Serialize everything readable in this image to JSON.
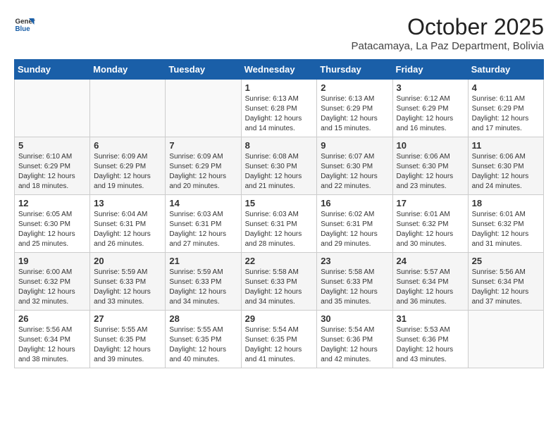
{
  "header": {
    "logo_line1": "General",
    "logo_line2": "Blue",
    "month": "October 2025",
    "location": "Patacamaya, La Paz Department, Bolivia"
  },
  "weekdays": [
    "Sunday",
    "Monday",
    "Tuesday",
    "Wednesday",
    "Thursday",
    "Friday",
    "Saturday"
  ],
  "weeks": [
    [
      {
        "day": "",
        "info": ""
      },
      {
        "day": "",
        "info": ""
      },
      {
        "day": "",
        "info": ""
      },
      {
        "day": "1",
        "info": "Sunrise: 6:13 AM\nSunset: 6:28 PM\nDaylight: 12 hours\nand 14 minutes."
      },
      {
        "day": "2",
        "info": "Sunrise: 6:13 AM\nSunset: 6:29 PM\nDaylight: 12 hours\nand 15 minutes."
      },
      {
        "day": "3",
        "info": "Sunrise: 6:12 AM\nSunset: 6:29 PM\nDaylight: 12 hours\nand 16 minutes."
      },
      {
        "day": "4",
        "info": "Sunrise: 6:11 AM\nSunset: 6:29 PM\nDaylight: 12 hours\nand 17 minutes."
      }
    ],
    [
      {
        "day": "5",
        "info": "Sunrise: 6:10 AM\nSunset: 6:29 PM\nDaylight: 12 hours\nand 18 minutes."
      },
      {
        "day": "6",
        "info": "Sunrise: 6:09 AM\nSunset: 6:29 PM\nDaylight: 12 hours\nand 19 minutes."
      },
      {
        "day": "7",
        "info": "Sunrise: 6:09 AM\nSunset: 6:29 PM\nDaylight: 12 hours\nand 20 minutes."
      },
      {
        "day": "8",
        "info": "Sunrise: 6:08 AM\nSunset: 6:30 PM\nDaylight: 12 hours\nand 21 minutes."
      },
      {
        "day": "9",
        "info": "Sunrise: 6:07 AM\nSunset: 6:30 PM\nDaylight: 12 hours\nand 22 minutes."
      },
      {
        "day": "10",
        "info": "Sunrise: 6:06 AM\nSunset: 6:30 PM\nDaylight: 12 hours\nand 23 minutes."
      },
      {
        "day": "11",
        "info": "Sunrise: 6:06 AM\nSunset: 6:30 PM\nDaylight: 12 hours\nand 24 minutes."
      }
    ],
    [
      {
        "day": "12",
        "info": "Sunrise: 6:05 AM\nSunset: 6:30 PM\nDaylight: 12 hours\nand 25 minutes."
      },
      {
        "day": "13",
        "info": "Sunrise: 6:04 AM\nSunset: 6:31 PM\nDaylight: 12 hours\nand 26 minutes."
      },
      {
        "day": "14",
        "info": "Sunrise: 6:03 AM\nSunset: 6:31 PM\nDaylight: 12 hours\nand 27 minutes."
      },
      {
        "day": "15",
        "info": "Sunrise: 6:03 AM\nSunset: 6:31 PM\nDaylight: 12 hours\nand 28 minutes."
      },
      {
        "day": "16",
        "info": "Sunrise: 6:02 AM\nSunset: 6:31 PM\nDaylight: 12 hours\nand 29 minutes."
      },
      {
        "day": "17",
        "info": "Sunrise: 6:01 AM\nSunset: 6:32 PM\nDaylight: 12 hours\nand 30 minutes."
      },
      {
        "day": "18",
        "info": "Sunrise: 6:01 AM\nSunset: 6:32 PM\nDaylight: 12 hours\nand 31 minutes."
      }
    ],
    [
      {
        "day": "19",
        "info": "Sunrise: 6:00 AM\nSunset: 6:32 PM\nDaylight: 12 hours\nand 32 minutes."
      },
      {
        "day": "20",
        "info": "Sunrise: 5:59 AM\nSunset: 6:33 PM\nDaylight: 12 hours\nand 33 minutes."
      },
      {
        "day": "21",
        "info": "Sunrise: 5:59 AM\nSunset: 6:33 PM\nDaylight: 12 hours\nand 34 minutes."
      },
      {
        "day": "22",
        "info": "Sunrise: 5:58 AM\nSunset: 6:33 PM\nDaylight: 12 hours\nand 34 minutes."
      },
      {
        "day": "23",
        "info": "Sunrise: 5:58 AM\nSunset: 6:33 PM\nDaylight: 12 hours\nand 35 minutes."
      },
      {
        "day": "24",
        "info": "Sunrise: 5:57 AM\nSunset: 6:34 PM\nDaylight: 12 hours\nand 36 minutes."
      },
      {
        "day": "25",
        "info": "Sunrise: 5:56 AM\nSunset: 6:34 PM\nDaylight: 12 hours\nand 37 minutes."
      }
    ],
    [
      {
        "day": "26",
        "info": "Sunrise: 5:56 AM\nSunset: 6:34 PM\nDaylight: 12 hours\nand 38 minutes."
      },
      {
        "day": "27",
        "info": "Sunrise: 5:55 AM\nSunset: 6:35 PM\nDaylight: 12 hours\nand 39 minutes."
      },
      {
        "day": "28",
        "info": "Sunrise: 5:55 AM\nSunset: 6:35 PM\nDaylight: 12 hours\nand 40 minutes."
      },
      {
        "day": "29",
        "info": "Sunrise: 5:54 AM\nSunset: 6:35 PM\nDaylight: 12 hours\nand 41 minutes."
      },
      {
        "day": "30",
        "info": "Sunrise: 5:54 AM\nSunset: 6:36 PM\nDaylight: 12 hours\nand 42 minutes."
      },
      {
        "day": "31",
        "info": "Sunrise: 5:53 AM\nSunset: 6:36 PM\nDaylight: 12 hours\nand 43 minutes."
      },
      {
        "day": "",
        "info": ""
      }
    ]
  ]
}
